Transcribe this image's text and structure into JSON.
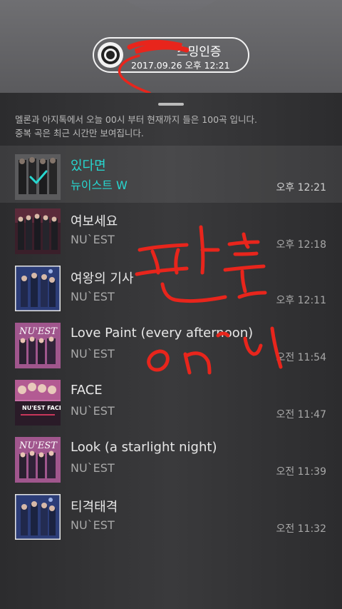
{
  "certificate": {
    "title_visible": "스밍인증",
    "date": "2017.09.26 오후 12:21",
    "icon": "disc-icon"
  },
  "notice": {
    "line1": "멜론과 아지톡에서 오늘 00시 부터 현재까지 들은 100곡 입니다.",
    "line2": "중복 곡은 최근 시간만 보여집니다."
  },
  "songs": [
    {
      "title": "있다면",
      "artist": "뉴이스트 W",
      "time": "오후 12:21",
      "selected": true
    },
    {
      "title": "여보세요",
      "artist": "NU`EST",
      "time": "오후 12:18"
    },
    {
      "title": "여왕의 기사",
      "artist": "NU`EST",
      "time": "오후 12:11"
    },
    {
      "title": "Love Paint (every afternoon)",
      "artist": "NU`EST",
      "time": "오전 11:54"
    },
    {
      "title": "FACE",
      "artist": "NU`EST",
      "time": "오전 11:47"
    },
    {
      "title": "Look (a starlight night)",
      "artist": "NU`EST",
      "time": "오전 11:39"
    },
    {
      "title": "티격태격",
      "artist": "NU`EST",
      "time": "오전 11:32"
    }
  ],
  "colors": {
    "accent": "#27d7d0",
    "scribble": "#e8251c"
  }
}
